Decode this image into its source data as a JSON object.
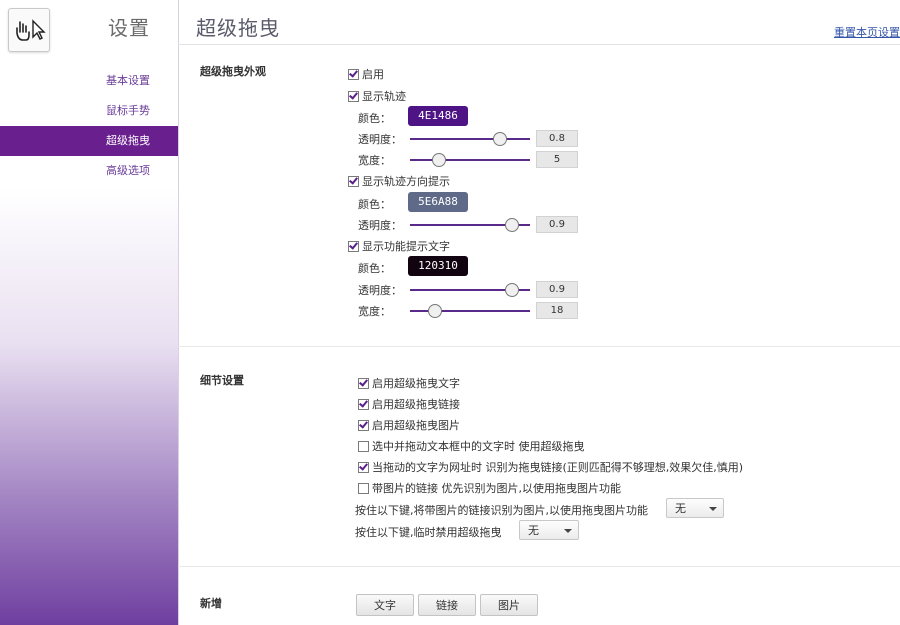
{
  "sidebar": {
    "title": "设置",
    "items": [
      {
        "label": "基本设置"
      },
      {
        "label": "鼠标手势"
      },
      {
        "label": "超级拖曳"
      },
      {
        "label": "高级选项"
      }
    ]
  },
  "header": {
    "title": "超级拖曳",
    "reset_link": "重置本页设置"
  },
  "appearance": {
    "section_label": "超级拖曳外观",
    "enable_label": "启用",
    "enable_checked": true,
    "show_trail_label": "显示轨迹",
    "show_trail_checked": true,
    "trail_color_label": "颜色：",
    "trail_color": "4E1486",
    "trail_opacity_label": "透明度：",
    "trail_opacity": "0.8",
    "trail_width_label": "宽度：",
    "trail_width": "5",
    "show_direction_label": "显示轨迹方向提示",
    "show_direction_checked": true,
    "direction_color_label": "颜色：",
    "direction_color": "5E6A88",
    "direction_opacity_label": "透明度：",
    "direction_opacity": "0.9",
    "show_text_label": "显示功能提示文字",
    "show_text_checked": true,
    "text_color_label": "颜色：",
    "text_color": "120310",
    "text_opacity_label": "透明度：",
    "text_opacity": "0.9",
    "text_width_label": "宽度：",
    "text_width": "18"
  },
  "details": {
    "section_label": "细节设置",
    "options": [
      {
        "label": "启用超级拖曳文字",
        "checked": true
      },
      {
        "label": "启用超级拖曳链接",
        "checked": true
      },
      {
        "label": "启用超级拖曳图片",
        "checked": true
      },
      {
        "label": "选中并拖动文本框中的文字时 使用超级拖曳",
        "checked": false
      },
      {
        "label": "当拖动的文字为网址时 识别为拖曳链接(正则匹配得不够理想,效果欠佳,慎用)",
        "checked": true
      },
      {
        "label": "带图片的链接 优先识别为图片,以使用拖曳图片功能",
        "checked": false
      }
    ],
    "key_image_label": "按住以下键,将带图片的链接识别为图片,以使用拖曳图片功能",
    "key_image_value": "无",
    "key_disable_label": "按住以下键,临时禁用超级拖曳",
    "key_disable_value": "无"
  },
  "newrule": {
    "section_label": "新增",
    "buttons": [
      "文字",
      "链接",
      "图片"
    ]
  },
  "colors": {
    "accent": "#6a1f8f",
    "trail": "#4E1486",
    "direction": "#5E6A88",
    "text": "#120310"
  }
}
